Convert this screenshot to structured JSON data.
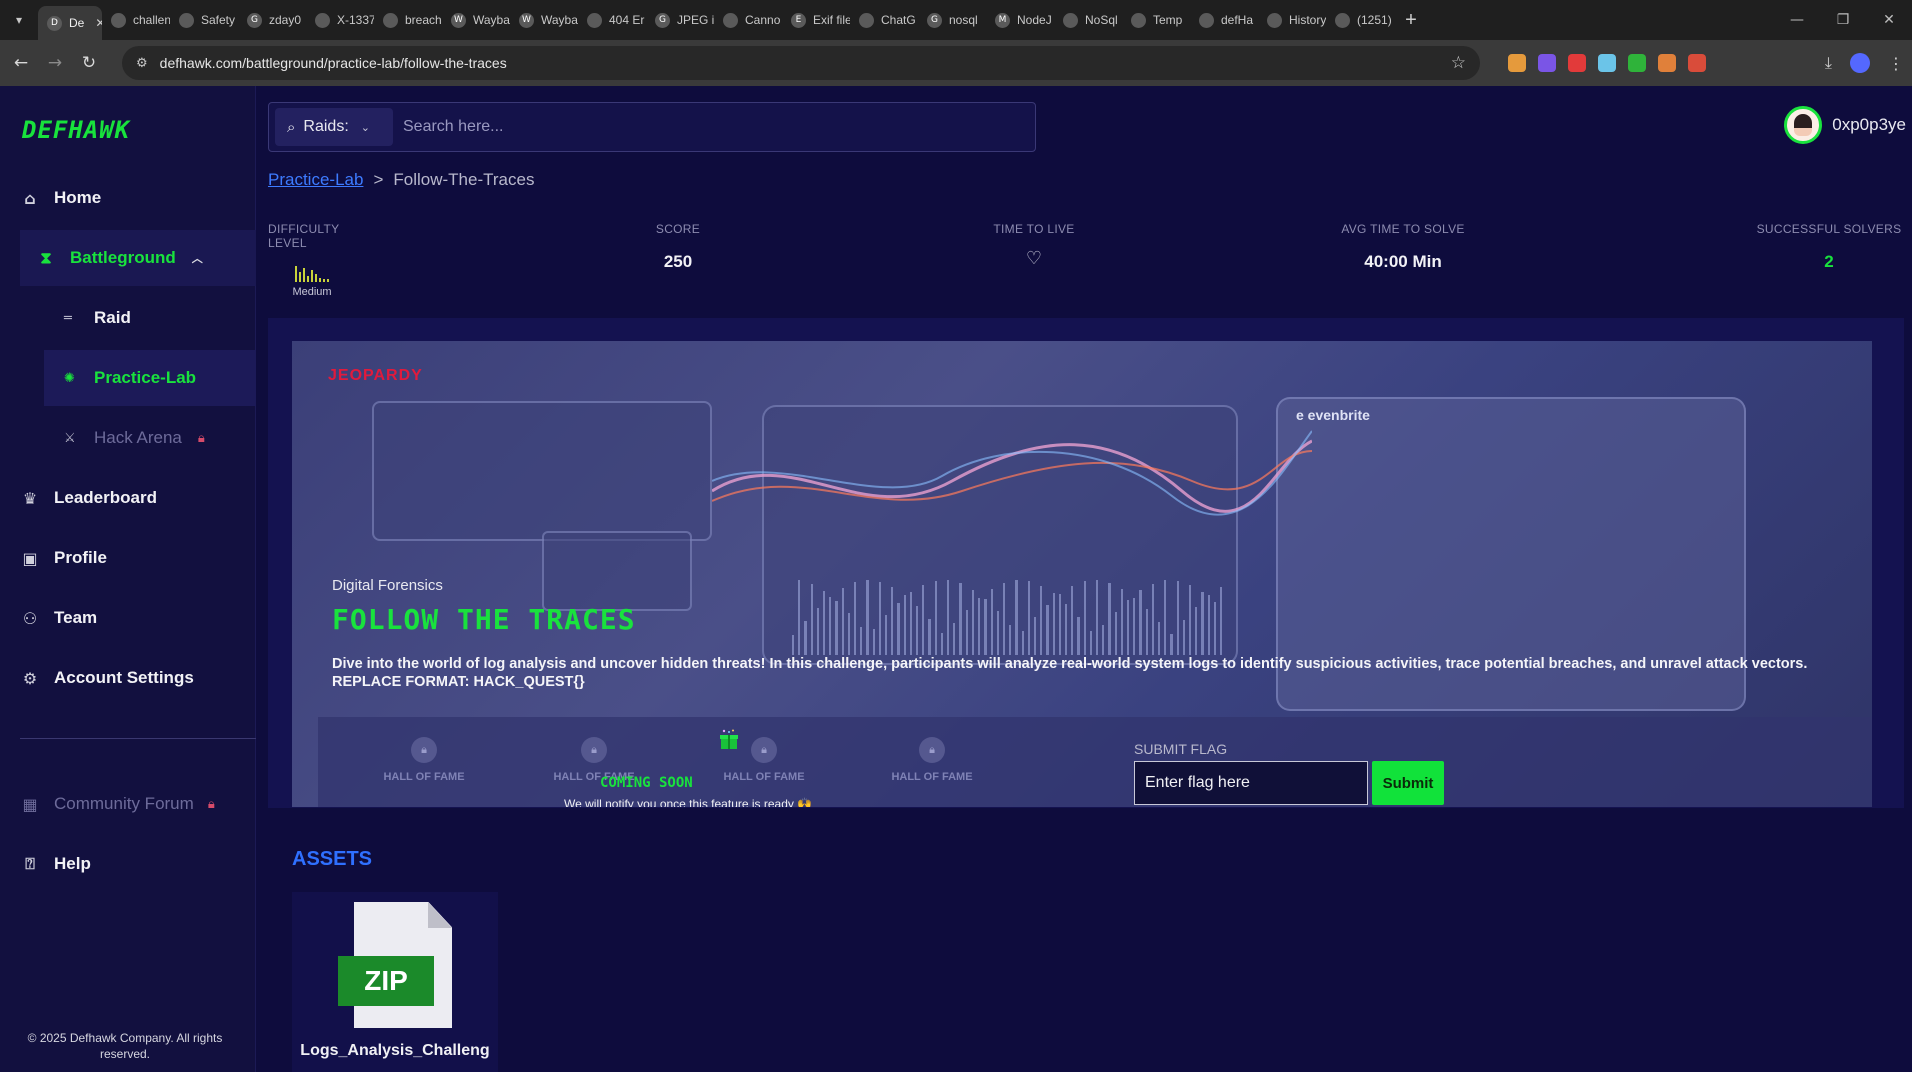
{
  "browser": {
    "tabs": [
      {
        "label": "De",
        "active": true,
        "fav": "D"
      },
      {
        "label": "challen",
        "fav": ""
      },
      {
        "label": "Safety wan",
        "fav": ""
      },
      {
        "label": "zday0",
        "fav": "G"
      },
      {
        "label": "X-1337",
        "fav": ""
      },
      {
        "label": "breach",
        "fav": ""
      },
      {
        "label": "Wayba",
        "fav": "W"
      },
      {
        "label": "Wayba",
        "fav": "W"
      },
      {
        "label": "404 Er",
        "fav": ""
      },
      {
        "label": "JPEG ir",
        "fav": "G"
      },
      {
        "label": "Canno",
        "fav": ""
      },
      {
        "label": "Exif file",
        "fav": "E"
      },
      {
        "label": "ChatG",
        "fav": ""
      },
      {
        "label": "nosql",
        "fav": "G"
      },
      {
        "label": "NodeJ",
        "fav": "M"
      },
      {
        "label": "NoSql",
        "fav": ""
      },
      {
        "label": "Temp",
        "fav": ""
      },
      {
        "label": "defHa",
        "fav": ""
      },
      {
        "label": "History",
        "fav": ""
      },
      {
        "label": "(1251)",
        "fav": ""
      }
    ],
    "url": "defhawk.com/battleground/practice-lab/follow-the-traces",
    "ext_colors": [
      "#e59a3c",
      "#7a55e6",
      "#e23a3a",
      "#6bc4e8",
      "#2fb33a",
      "#e0803a",
      "#d94c3a"
    ]
  },
  "sidebar": {
    "logo": "DEFHAWK",
    "items": {
      "home": "Home",
      "battleground": "Battleground",
      "raid": "Raid",
      "practice_lab": "Practice-Lab",
      "hack_arena": "Hack Arena",
      "leaderboard": "Leaderboard",
      "profile": "Profile",
      "team": "Team",
      "account_settings": "Account Settings",
      "community_forum": "Community Forum",
      "help": "Help"
    },
    "copyright": "© 2025 Defhawk Company. All rights reserved."
  },
  "header": {
    "filter": "Raids:",
    "search_placeholder": "Search here...",
    "username": "0xp0p3ye"
  },
  "breadcrumb": {
    "parent": "Practice-Lab",
    "separator": ">",
    "current": "Follow-The-Traces"
  },
  "stats": {
    "difficulty_label": "DIFFICULTY LEVEL",
    "difficulty_value": "Medium",
    "score_label": "SCORE",
    "score_value": "250",
    "ttl_label": "TIME TO LIVE",
    "avg_label": "AVG TIME TO SOLVE",
    "avg_value": "40:00 Min",
    "solvers_label": "SUCCESSFUL SOLVERS",
    "solvers_value": "2"
  },
  "challenge": {
    "type": "JEOPARDY",
    "category": "Digital Forensics",
    "title": "FOLLOW THE TRACES",
    "description": "Dive into the world of log analysis and uncover hidden threats! In this challenge, participants will analyze real-world system logs to identify suspicious activities, trace potential breaches, and unravel attack vectors. REPLACE FORMAT: HACK_QUEST{}",
    "hall_of_fame_label": "HALL OF FAME",
    "coming_soon": "COMING SOON",
    "notify": "We will notify you once this feature is ready 🙌",
    "submit_label": "SUBMIT FLAG",
    "flag_placeholder": "Enter flag here",
    "submit_button": "Submit"
  },
  "assets": {
    "title": "ASSETS",
    "badge": "ZIP",
    "file_name": "Logs_Analysis_Challeng"
  },
  "colors": {
    "accent_green": "#19e23d",
    "link_blue": "#3d7bff",
    "jeopardy_red": "#e11a3c",
    "background": "#0e0c3d"
  }
}
